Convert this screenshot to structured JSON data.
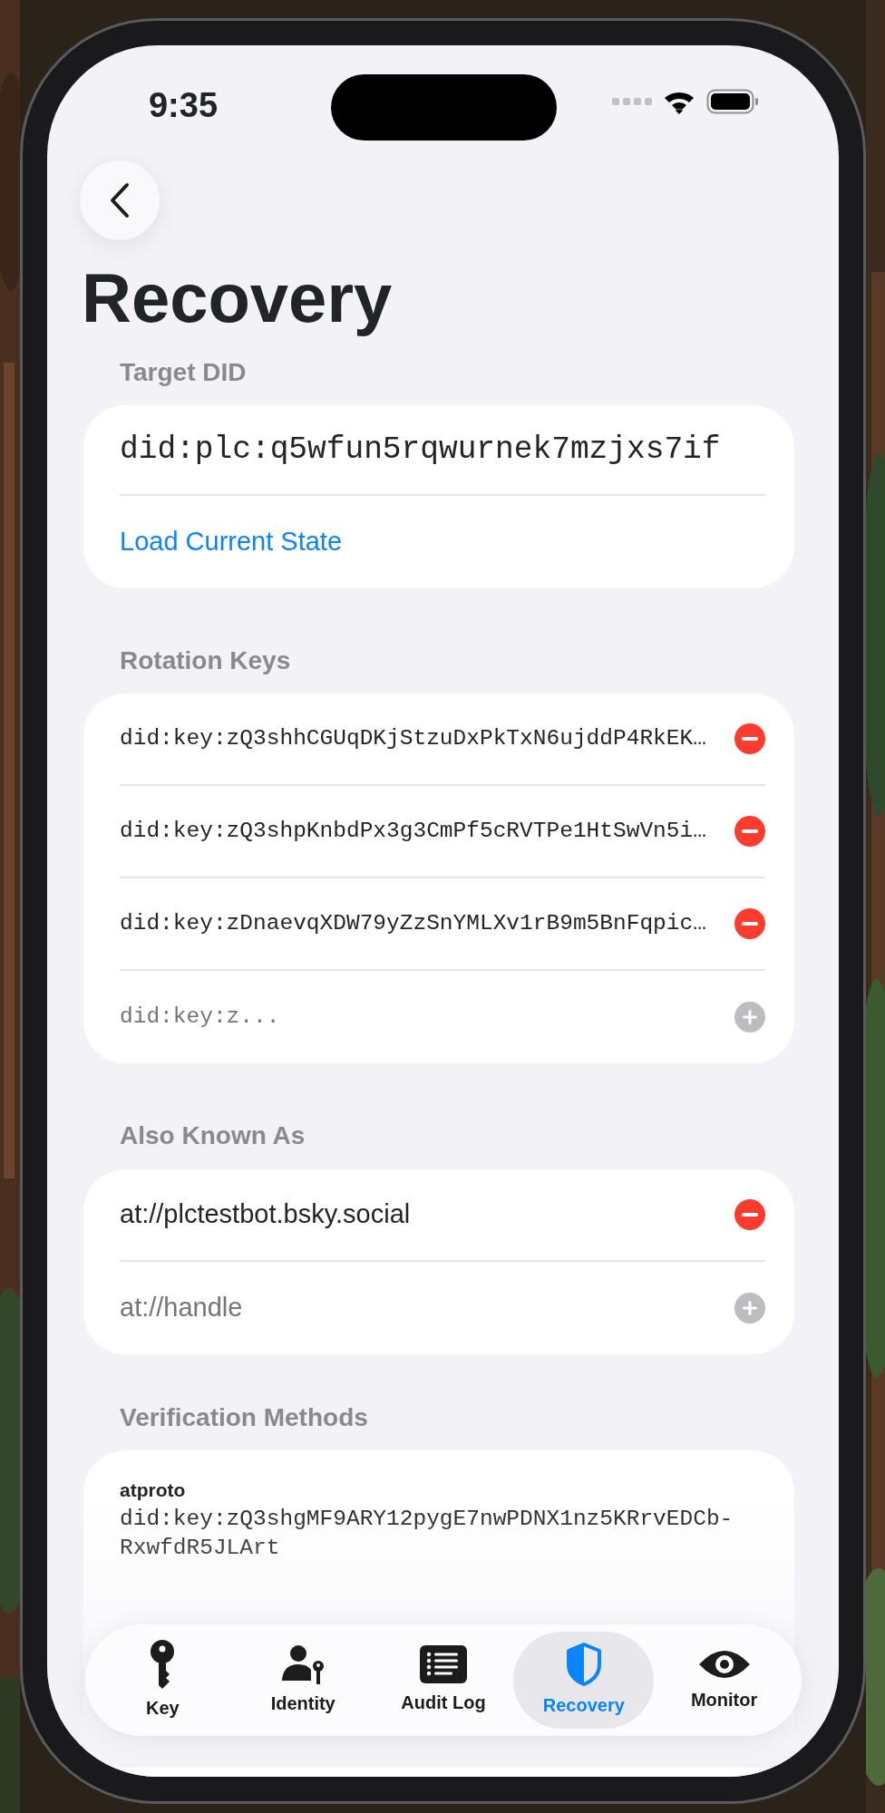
{
  "status_bar": {
    "time": "9:35"
  },
  "title": "Recovery",
  "target_did": {
    "header": "Target DID",
    "value": "did:plc:q5wfun5rqwurnek7mzjxs7if",
    "action": "Load Current State"
  },
  "rotation_keys": {
    "header": "Rotation Keys",
    "items": [
      "did:key:zQ3shhCGUqDKjStzuDxPkTxN6ujddP4RkEK…",
      "did:key:zQ3shpKnbdPx3g3CmPf5cRVTPe1HtSwVn5i…",
      "did:key:zDnaevqXDW79yZzSnYMLXv1rB9m5BnFqpic…"
    ],
    "placeholder": "did:key:z..."
  },
  "also_known_as": {
    "header": "Also Known As",
    "items": [
      "at://plctestbot.bsky.social"
    ],
    "placeholder": "at://handle"
  },
  "verification_methods": {
    "header": "Verification Methods",
    "items": [
      {
        "name": "atproto",
        "value": "did:key:zQ3shgMF9ARY12pygE7nwPDNX1nz5KRrvEDCb-RxwfdR5JLArt"
      }
    ]
  },
  "tabs": [
    {
      "label": "Key",
      "selected": false
    },
    {
      "label": "Identity",
      "selected": false
    },
    {
      "label": "Audit Log",
      "selected": false
    },
    {
      "label": "Recovery",
      "selected": true
    },
    {
      "label": "Monitor",
      "selected": false
    }
  ]
}
